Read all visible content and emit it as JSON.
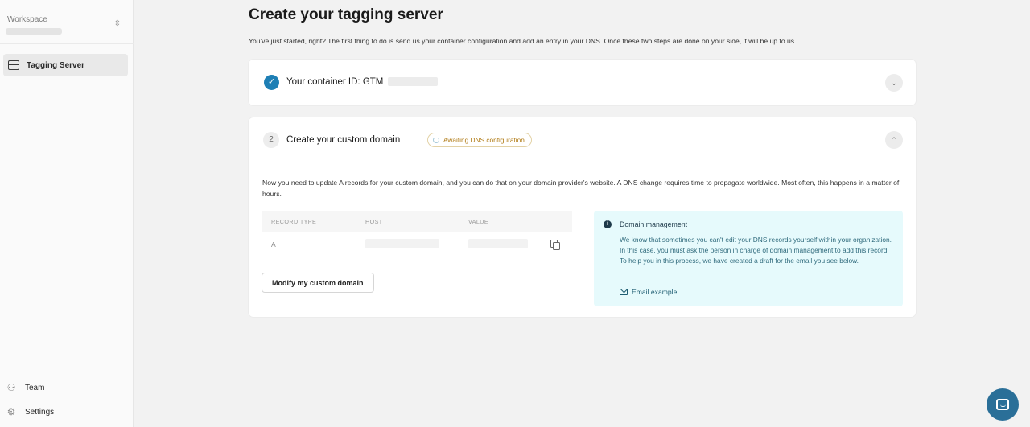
{
  "sidebar": {
    "workspace_label": "Workspace",
    "nav_items": [
      {
        "label": "Tagging Server",
        "icon": "server-icon",
        "active": true
      }
    ],
    "bottom_items": [
      {
        "label": "Team",
        "icon": "team-icon"
      },
      {
        "label": "Settings",
        "icon": "gear-icon"
      }
    ]
  },
  "main": {
    "title": "Create your tagging server",
    "subtitle": "You've just started, right? The first thing to do is send us your container configuration and add an entry in your DNS. Once these two steps are done on your side, it will be up to us.",
    "step1": {
      "title": "Your container ID: GTM",
      "status": "complete",
      "accent_color": "#1e7fb5"
    },
    "step2": {
      "number": "2",
      "title": "Create your custom domain",
      "badge": "Awaiting DNS configuration",
      "description": "Now you need to update A records for your custom domain, and you can do that on your domain provider's website. A DNS change requires time to propagate worldwide. Most often, this happens in a matter of hours.",
      "table": {
        "headers": [
          "RECORD TYPE",
          "HOST",
          "VALUE"
        ],
        "rows": [
          {
            "type": "A"
          }
        ]
      },
      "modify_button": "Modify my custom domain",
      "info": {
        "title": "Domain management",
        "text": "We know that sometimes you can't edit your DNS records yourself within your organization. In this case, you must ask the person in charge of domain management to add this record. To help you in this process, we have created a draft for the email you see below.",
        "link": "Email example"
      }
    }
  }
}
